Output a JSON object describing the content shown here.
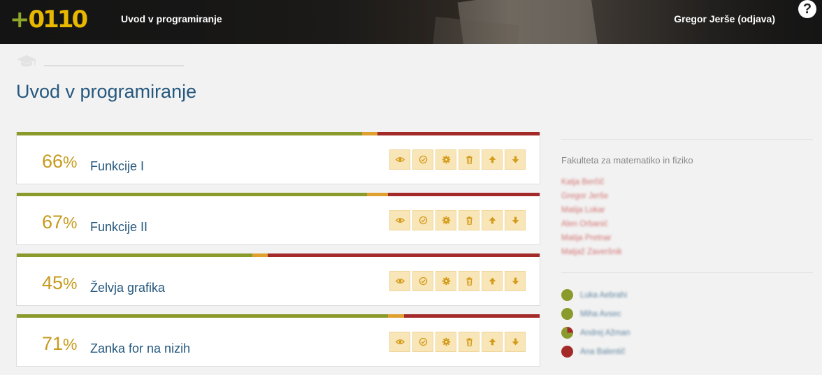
{
  "header": {
    "logo_plus": "+",
    "logo_text": "0110",
    "course": "Uvod v programiranje",
    "user": "Gregor Jerše (odjava)",
    "help": "?"
  },
  "breadcrumb": {
    "icon": "graduation-cap-icon"
  },
  "page": {
    "title": "Uvod v programiranje"
  },
  "problem_sets": [
    {
      "percent": "66",
      "sign": "%",
      "name": "Funkcije I",
      "solved": 0.66,
      "partial": 0.03
    },
    {
      "percent": "67",
      "sign": "%",
      "name": "Funkcije II",
      "solved": 0.67,
      "partial": 0.04
    },
    {
      "percent": "45",
      "sign": "%",
      "name": "Želvja grafika",
      "solved": 0.45,
      "partial": 0.03
    },
    {
      "percent": "71",
      "sign": "%",
      "name": "Zanka for na nizih",
      "solved": 0.71,
      "partial": 0.03
    }
  ],
  "actions": [
    "eye-icon",
    "check-circle-icon",
    "gear-icon",
    "trash-icon",
    "arrow-up-icon",
    "arrow-down-icon"
  ],
  "sidebar": {
    "faculty": "Fakulteta za matematiko in fiziko",
    "teachers": [
      "Katja Berčič",
      "Gregor Jerše",
      "Matija Lokar",
      "Alen Orbanić",
      "Matija Pretnar",
      "Matjaž Zaveršnik"
    ],
    "students": [
      {
        "name": "Luka Aebrahi",
        "done": 1.0
      },
      {
        "name": "Miha Avsec",
        "done": 1.0
      },
      {
        "name": "Andrej Ažman",
        "done": 0.75
      },
      {
        "name": "Ana Balentič",
        "done": 0.0
      }
    ]
  },
  "colors": {
    "solved": "#8a9a2b",
    "partial": "#e0a030",
    "unsolved": "#a42a2a",
    "title": "#25587e",
    "percent": "#c79a1c"
  }
}
